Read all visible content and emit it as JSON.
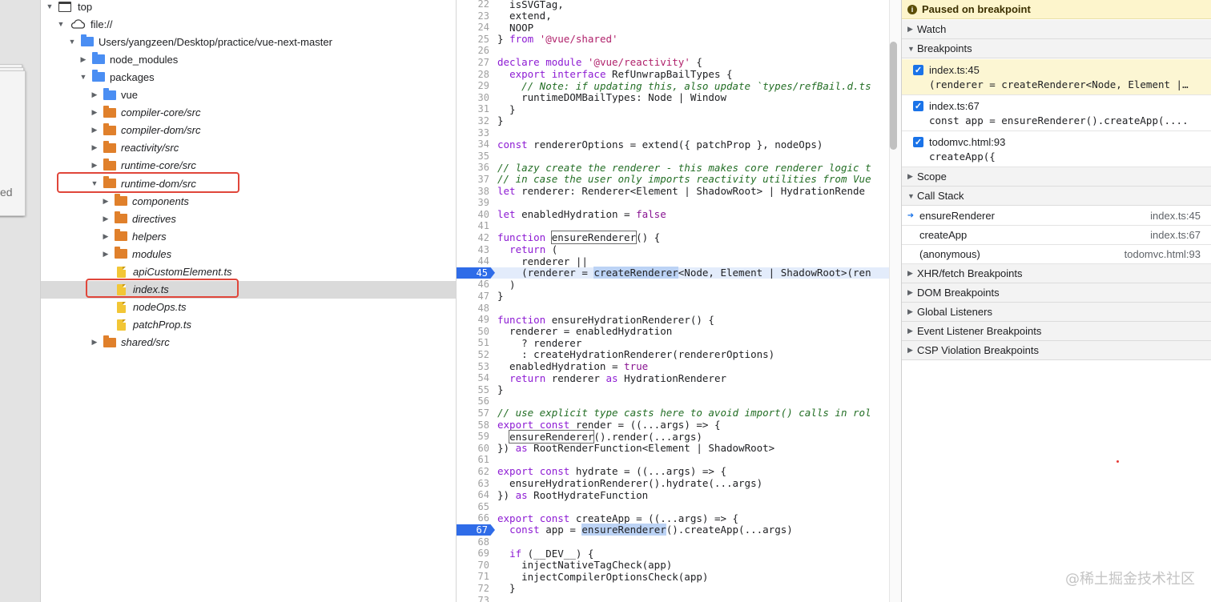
{
  "navigator": {
    "items": [
      {
        "label": "top",
        "kind": "frame",
        "expanded": true,
        "selected": false,
        "italic": false
      },
      {
        "label": "file://",
        "kind": "cloud",
        "expanded": true,
        "selected": false,
        "italic": false
      },
      {
        "label": "Users/yangzeen/Desktop/practice/vue-next-master",
        "kind": "folder-blue",
        "expanded": true,
        "selected": false,
        "italic": false
      },
      {
        "label": "node_modules",
        "kind": "folder-blue",
        "expanded": false,
        "selected": false,
        "italic": false
      },
      {
        "label": "packages",
        "kind": "folder-blue",
        "expanded": true,
        "selected": false,
        "italic": false
      },
      {
        "label": "vue",
        "kind": "folder-blue",
        "expanded": false,
        "selected": false,
        "italic": false
      },
      {
        "label": "compiler-core/src",
        "kind": "folder-orange",
        "expanded": false,
        "selected": false,
        "italic": true
      },
      {
        "label": "compiler-dom/src",
        "kind": "folder-orange",
        "expanded": false,
        "selected": false,
        "italic": true
      },
      {
        "label": "reactivity/src",
        "kind": "folder-orange",
        "expanded": false,
        "selected": false,
        "italic": true
      },
      {
        "label": "runtime-core/src",
        "kind": "folder-orange",
        "expanded": false,
        "selected": false,
        "italic": true
      },
      {
        "label": "runtime-dom/src",
        "kind": "folder-orange",
        "expanded": true,
        "selected": false,
        "italic": true
      },
      {
        "label": "components",
        "kind": "folder-orange",
        "expanded": false,
        "selected": false,
        "italic": true
      },
      {
        "label": "directives",
        "kind": "folder-orange",
        "expanded": false,
        "selected": false,
        "italic": true
      },
      {
        "label": "helpers",
        "kind": "folder-orange",
        "expanded": false,
        "selected": false,
        "italic": true
      },
      {
        "label": "modules",
        "kind": "folder-orange",
        "expanded": false,
        "selected": false,
        "italic": true
      },
      {
        "label": "apiCustomElement.ts",
        "kind": "file",
        "expanded": false,
        "selected": false,
        "italic": true
      },
      {
        "label": "index.ts",
        "kind": "file",
        "expanded": false,
        "selected": true,
        "italic": true
      },
      {
        "label": "nodeOps.ts",
        "kind": "file",
        "expanded": false,
        "selected": false,
        "italic": true
      },
      {
        "label": "patchProp.ts",
        "kind": "file",
        "expanded": false,
        "selected": false,
        "italic": true
      },
      {
        "label": "shared/src",
        "kind": "folder-orange",
        "expanded": false,
        "selected": false,
        "italic": true
      }
    ]
  },
  "editor": {
    "lines": [
      {
        "n": "22",
        "t": "  isSVGTag,"
      },
      {
        "n": "23",
        "t": "  extend,"
      },
      {
        "n": "24",
        "t": "  NOOP"
      },
      {
        "n": "25",
        "t": "} from '@vue/shared'"
      },
      {
        "n": "26",
        "t": ""
      },
      {
        "n": "27",
        "t": "declare module '@vue/reactivity' {"
      },
      {
        "n": "28",
        "t": "  export interface RefUnwrapBailTypes {"
      },
      {
        "n": "29",
        "t": "    // Note: if updating this, also update `types/refBail.d.ts"
      },
      {
        "n": "30",
        "t": "    runtimeDOMBailTypes: Node | Window"
      },
      {
        "n": "31",
        "t": "  }"
      },
      {
        "n": "32",
        "t": "}"
      },
      {
        "n": "33",
        "t": ""
      },
      {
        "n": "34",
        "t": "const rendererOptions = extend({ patchProp }, nodeOps)"
      },
      {
        "n": "35",
        "t": ""
      },
      {
        "n": "36",
        "t": "// lazy create the renderer - this makes core renderer logic t"
      },
      {
        "n": "37",
        "t": "// in case the user only imports reactivity utilities from Vue"
      },
      {
        "n": "38",
        "t": "let renderer: Renderer<Element | ShadowRoot> | HydrationRende"
      },
      {
        "n": "39",
        "t": ""
      },
      {
        "n": "40",
        "t": "let enabledHydration = false"
      },
      {
        "n": "41",
        "t": ""
      },
      {
        "n": "42",
        "t": "function ensureRenderer() {"
      },
      {
        "n": "43",
        "t": "  return ("
      },
      {
        "n": "44",
        "t": "    renderer ||"
      },
      {
        "n": "45",
        "t": "    (renderer = createRenderer<Node, Element | ShadowRoot>(ren"
      },
      {
        "n": "46",
        "t": "  )"
      },
      {
        "n": "47",
        "t": "}"
      },
      {
        "n": "48",
        "t": ""
      },
      {
        "n": "49",
        "t": "function ensureHydrationRenderer() {"
      },
      {
        "n": "50",
        "t": "  renderer = enabledHydration"
      },
      {
        "n": "51",
        "t": "    ? renderer"
      },
      {
        "n": "52",
        "t": "    : createHydrationRenderer(rendererOptions)"
      },
      {
        "n": "53",
        "t": "  enabledHydration = true"
      },
      {
        "n": "54",
        "t": "  return renderer as HydrationRenderer"
      },
      {
        "n": "55",
        "t": "}"
      },
      {
        "n": "56",
        "t": ""
      },
      {
        "n": "57",
        "t": "// use explicit type casts here to avoid import() calls in rol"
      },
      {
        "n": "58",
        "t": "export const render = ((...args) => {"
      },
      {
        "n": "59",
        "t": "  ensureRenderer().render(...args)"
      },
      {
        "n": "60",
        "t": "}) as RootRenderFunction<Element | ShadowRoot>"
      },
      {
        "n": "61",
        "t": ""
      },
      {
        "n": "62",
        "t": "export const hydrate = ((...args) => {"
      },
      {
        "n": "63",
        "t": "  ensureHydrationRenderer().hydrate(...args)"
      },
      {
        "n": "64",
        "t": "}) as RootHydrateFunction"
      },
      {
        "n": "65",
        "t": ""
      },
      {
        "n": "66",
        "t": "export const createApp = ((...args) => {"
      },
      {
        "n": "67",
        "t": "  const app = ensureRenderer().createApp(...args)"
      },
      {
        "n": "68",
        "t": ""
      },
      {
        "n": "69",
        "t": "  if (__DEV__) {"
      },
      {
        "n": "70",
        "t": "    injectNativeTagCheck(app)"
      },
      {
        "n": "71",
        "t": "    injectCompilerOptionsCheck(app)"
      },
      {
        "n": "72",
        "t": "  }"
      },
      {
        "n": "73",
        "t": ""
      }
    ],
    "breakpoint_lines": [
      "45",
      "67"
    ]
  },
  "sidebar": {
    "paused_label": "Paused on breakpoint",
    "watch_label": "Watch",
    "breakpoints_label": "Breakpoints",
    "breakpoints": [
      {
        "title": "index.ts:45",
        "code": "(renderer = createRenderer<Node, Element |…",
        "active": true
      },
      {
        "title": "index.ts:67",
        "code": "const app = ensureRenderer().createApp(....",
        "active": false
      },
      {
        "title": "todomvc.html:93",
        "code": "createApp({",
        "active": false
      }
    ],
    "scope_label": "Scope",
    "callstack_label": "Call Stack",
    "callstack": [
      {
        "fn": "ensureRenderer",
        "loc": "index.ts:45",
        "current": true
      },
      {
        "fn": "createApp",
        "loc": "index.ts:67",
        "current": false
      },
      {
        "fn": "(anonymous)",
        "loc": "todomvc.html:93",
        "current": false
      }
    ],
    "sections": [
      "XHR/fetch Breakpoints",
      "DOM Breakpoints",
      "Global Listeners",
      "Event Listener Breakpoints",
      "CSP Violation Breakpoints"
    ]
  },
  "left_partial_text": "ed",
  "watermark": "@稀土掘金技术社区",
  "colors": {
    "breakpoint_blue": "#2f6ce8",
    "folder_blue": "#4a8ef3",
    "folder_orange": "#e0802b",
    "file_yellow": "#f2c636",
    "paused_bg": "#fdf5cc",
    "highlight_red": "#e0463a"
  }
}
